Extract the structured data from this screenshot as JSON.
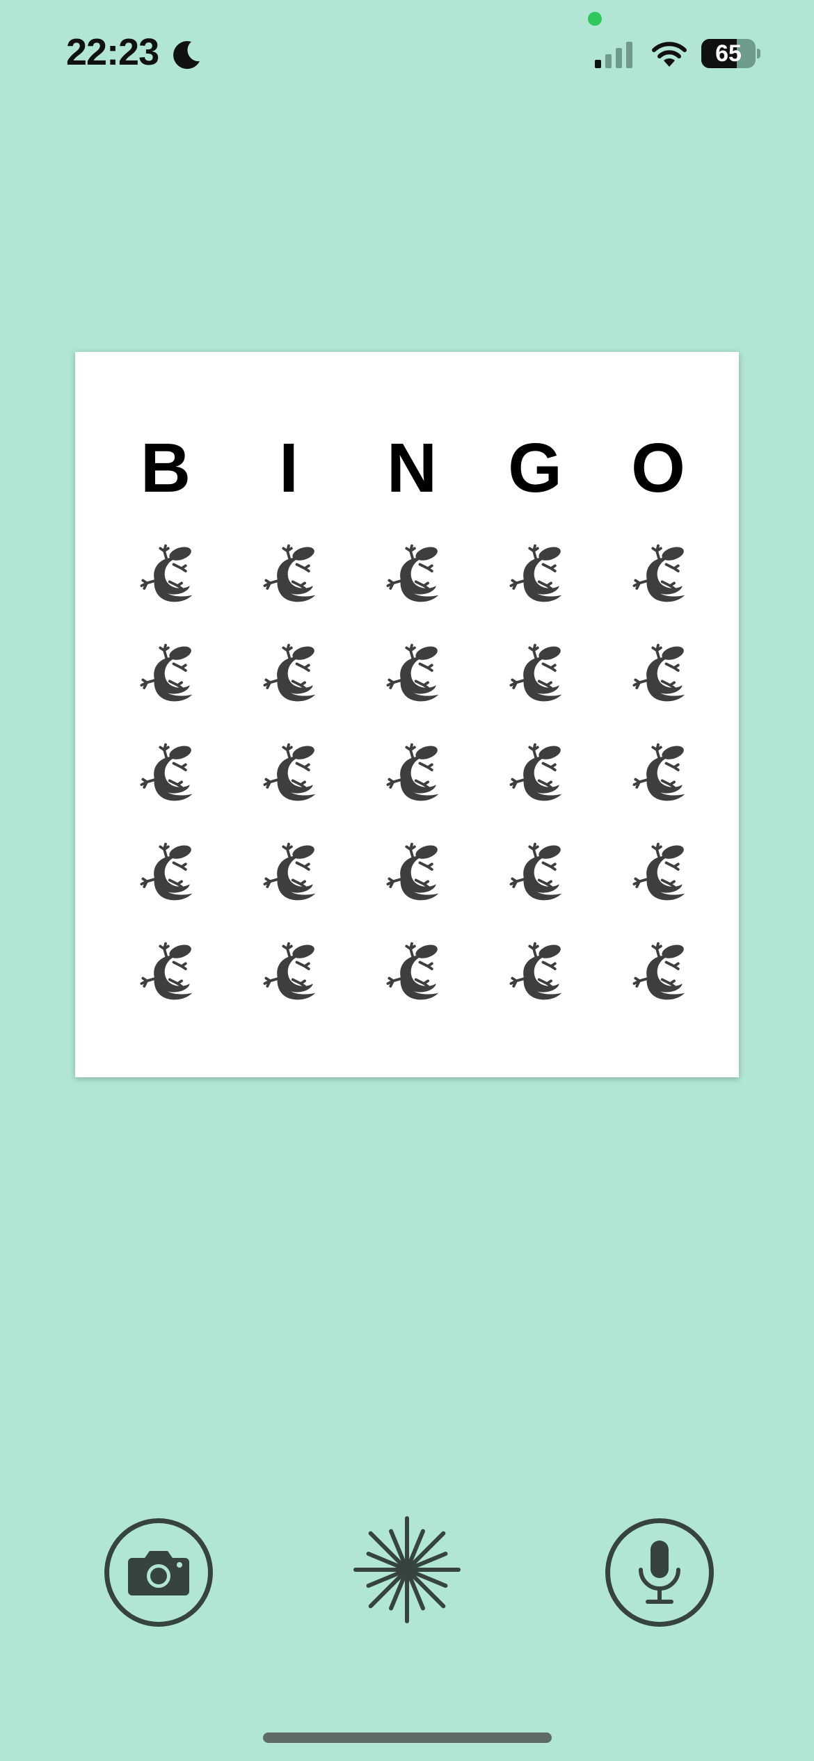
{
  "status_bar": {
    "time": "22:23",
    "focus_icon": "moon-icon",
    "signal_icon": "cellular-signal-icon",
    "wifi_icon": "wifi-icon",
    "battery_level": "65",
    "battery_fraction": 0.65
  },
  "bingo": {
    "letters": [
      "B",
      "I",
      "N",
      "G",
      "O"
    ],
    "cell_icon": "gecko-icon",
    "rows": 5,
    "columns": 5
  },
  "toolbar": {
    "camera_icon": "camera-icon",
    "generate_icon": "sparkle-burst-icon",
    "microphone_icon": "microphone-icon"
  },
  "colors": {
    "background": "#b0e6d3",
    "card": "#ffffff",
    "icon_dark": "#3e3e3e",
    "control_stroke": "#36433f"
  }
}
